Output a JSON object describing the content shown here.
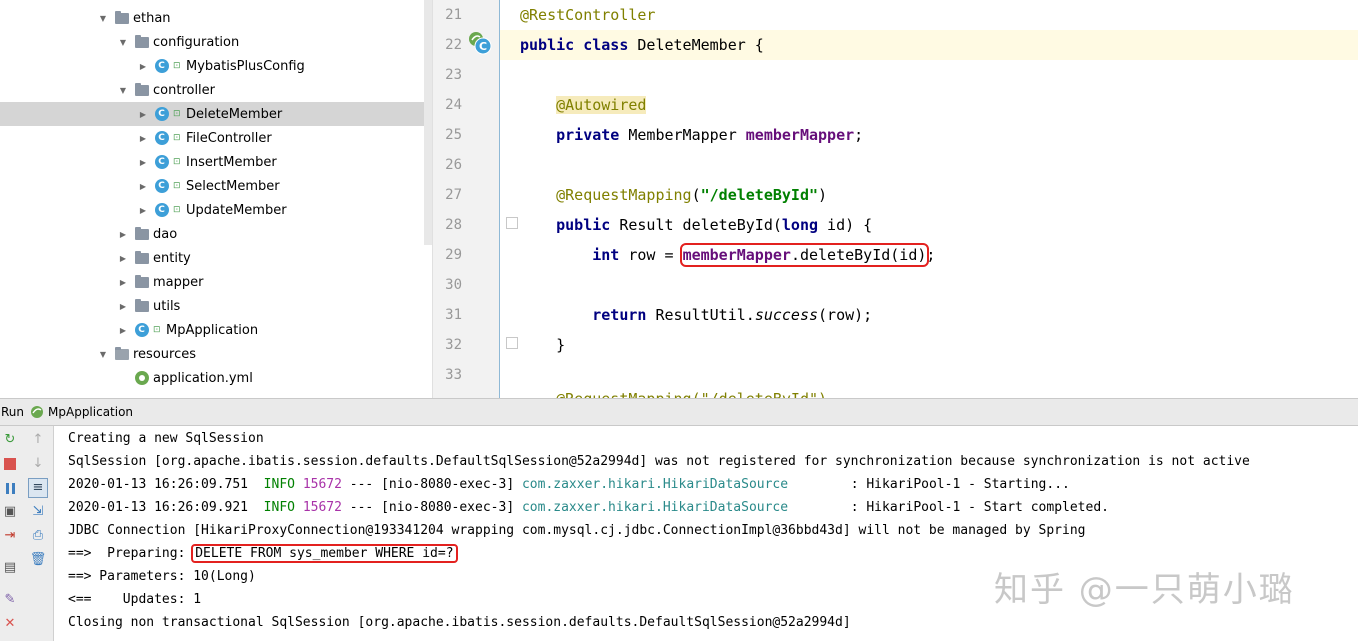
{
  "tree": {
    "items": [
      {
        "label": "ethan",
        "kind": "folder",
        "arrow": "▼",
        "indent": 1
      },
      {
        "label": "configuration",
        "kind": "folder",
        "arrow": "▼",
        "indent": 2
      },
      {
        "label": "MybatisPlusConfig",
        "kind": "class",
        "arrow": "▶",
        "indent": 3
      },
      {
        "label": "controller",
        "kind": "folder",
        "arrow": "▼",
        "indent": 2
      },
      {
        "label": "DeleteMember",
        "kind": "class",
        "arrow": "▶",
        "indent": 3,
        "selected": true
      },
      {
        "label": "FileController",
        "kind": "class",
        "arrow": "▶",
        "indent": 3
      },
      {
        "label": "InsertMember",
        "kind": "class",
        "arrow": "▶",
        "indent": 3
      },
      {
        "label": "SelectMember",
        "kind": "class",
        "arrow": "▶",
        "indent": 3
      },
      {
        "label": "UpdateMember",
        "kind": "class",
        "arrow": "▶",
        "indent": 3
      },
      {
        "label": "dao",
        "kind": "folder",
        "arrow": "▶",
        "indent": 2
      },
      {
        "label": "entity",
        "kind": "folder",
        "arrow": "▶",
        "indent": 2
      },
      {
        "label": "mapper",
        "kind": "folder",
        "arrow": "▶",
        "indent": 2
      },
      {
        "label": "utils",
        "kind": "folder",
        "arrow": "▶",
        "indent": 2
      },
      {
        "label": "MpApplication",
        "kind": "app",
        "arrow": "▶",
        "indent": 2
      },
      {
        "label": "resources",
        "kind": "resfolder",
        "arrow": "▼",
        "indent": 1
      },
      {
        "label": "application.yml",
        "kind": "yml",
        "arrow": "",
        "indent": 2
      }
    ]
  },
  "editor": {
    "line_numbers": [
      "21",
      "22",
      "23",
      "24",
      "25",
      "26",
      "27",
      "28",
      "29",
      "30",
      "31",
      "32",
      "33"
    ],
    "lines": {
      "l21": "@RestController",
      "l22_kw": "public class",
      "l22_rest": " DeleteMember {",
      "l24": "@Autowired",
      "l25_kw": "private",
      "l25_type": " MemberMapper ",
      "l25_field": "memberMapper",
      "l25_end": ";",
      "l27_ann": "@RequestMapping",
      "l27_open": "(",
      "l27_str": "\"/deleteById\"",
      "l27_close": ")",
      "l28_kw": "public",
      "l28_mid": " Result deleteById(",
      "l28_kw2": "long",
      "l28_end": " id) {",
      "l29_kw": "int",
      "l29_mid": " row = ",
      "l29_field": "memberMapper",
      "l29_call": ".deleteById(id)",
      "l29_end": ";",
      "l31_kw": "return",
      "l31_mid": " ResultUtil.",
      "l31_stat": "success",
      "l31_end": "(row);",
      "l32": "}",
      "l34_partial": "@RequestMapping(\"/deleteById\")"
    }
  },
  "run": {
    "label": "Run",
    "app": "MpApplication"
  },
  "console": {
    "line1": "Creating a new SqlSession",
    "line2": "SqlSession [org.apache.ibatis.session.defaults.DefaultSqlSession@52a2994d] was not registered for synchronization because synchronization is not active",
    "line3_time": "2020-01-13 16:26:09.751  ",
    "line3_level": "INFO",
    "line3_pid": "15672",
    "line3_mid": " --- [nio-8080-exec-3] ",
    "line3_logger": "com.zaxxer.hikari.HikariDataSource      ",
    "line3_msg": "  : HikariPool-1 - Starting...",
    "line4_time": "2020-01-13 16:26:09.921  ",
    "line4_level": "INFO",
    "line4_pid": "15672",
    "line4_mid": " --- [nio-8080-exec-3] ",
    "line4_logger": "com.zaxxer.hikari.HikariDataSource      ",
    "line4_msg": "  : HikariPool-1 - Start completed.",
    "line5": "JDBC Connection [HikariProxyConnection@193341204 wrapping com.mysql.cj.jdbc.ConnectionImpl@36bbd43d] will not be managed by Spring",
    "line6_prefix": "==>  Preparing: ",
    "line6_sql": "DELETE FROM sys_member WHERE id=?",
    "line7": "==> Parameters: 10(Long)",
    "line8": "<==    Updates: 1",
    "line9": "Closing non transactional SqlSession [org.apache.ibatis.session.defaults.DefaultSqlSession@52a2994d]"
  },
  "watermark": "知乎 @一只萌小璐",
  "colors": {
    "keyword": "#000080",
    "annotation": "#808000",
    "field": "#660e7a",
    "string": "#008000",
    "highlight_box": "#e3211f",
    "selection": "#d5d5d5"
  }
}
